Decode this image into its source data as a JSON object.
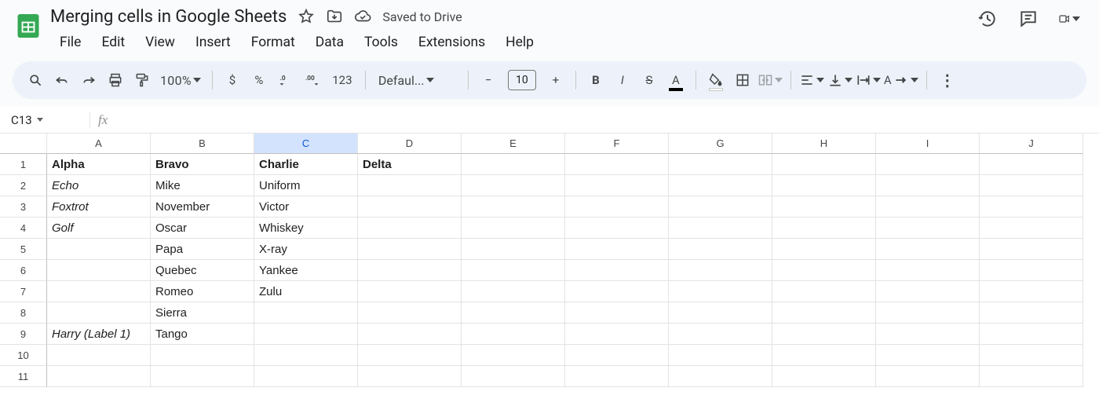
{
  "doc": {
    "title": "Merging cells in Google Sheets",
    "saved_status": "Saved to Drive"
  },
  "menus": [
    "File",
    "Edit",
    "View",
    "Insert",
    "Format",
    "Data",
    "Tools",
    "Extensions",
    "Help"
  ],
  "toolbar": {
    "zoom": "100%",
    "font_name": "Defaul...",
    "font_size": "10",
    "currency_symbol": "$",
    "percent_symbol": "%",
    "number_label": "123"
  },
  "namebox": {
    "cell_ref": "C13"
  },
  "columns": [
    "A",
    "B",
    "C",
    "D",
    "E",
    "F",
    "G",
    "H",
    "I",
    "J"
  ],
  "selected_column_index": 2,
  "row_count": 11,
  "cells": {
    "r1": {
      "A": "Alpha",
      "B": "Bravo",
      "C": "Charlie",
      "D": "Delta"
    },
    "r2": {
      "A": "Echo",
      "B": "Mike",
      "C": "Uniform"
    },
    "r3": {
      "A": "Foxtrot",
      "B": "November",
      "C": "Victor"
    },
    "r4": {
      "A": "Golf",
      "B": "Oscar",
      "C": "Whiskey"
    },
    "r5": {
      "B": "Papa",
      "C": "X-ray"
    },
    "r6": {
      "B": "Quebec",
      "C": "Yankee"
    },
    "r7": {
      "B": "Romeo",
      "C": "Zulu"
    },
    "r8": {
      "B": "Sierra"
    },
    "r9": {
      "A": "Harry (Label 1)",
      "B": "Tango"
    }
  },
  "cell_styles": {
    "bold": [
      "r1.A",
      "r1.B",
      "r1.C",
      "r1.D"
    ],
    "italic": [
      "r2.A",
      "r3.A",
      "r4.A",
      "r9.A"
    ]
  }
}
